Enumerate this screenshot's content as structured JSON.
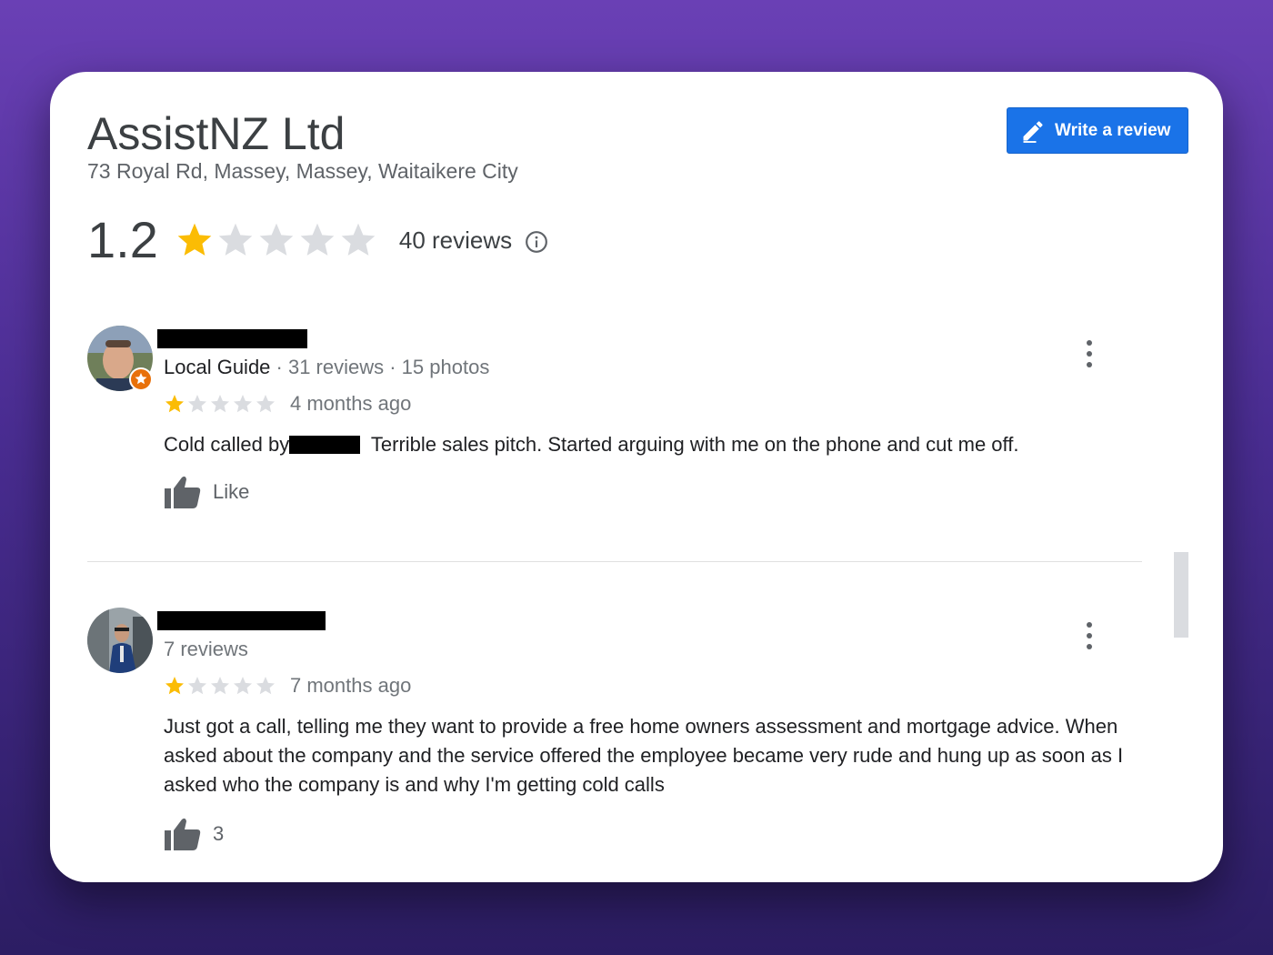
{
  "business": {
    "name": "AssistNZ Ltd",
    "address": "73 Royal Rd, Massey, Massey, Waitaikere City",
    "rating": "1.2",
    "rating_stars": 1,
    "reviews_label": "40 reviews"
  },
  "actions": {
    "write_review_label": "Write a review"
  },
  "colors": {
    "star_filled": "#fbbc04",
    "star_empty": "#dadce0",
    "accent": "#1a73e8"
  },
  "reviews": [
    {
      "meta_guide": "Local Guide",
      "meta_rest": " · 31 reviews · 15 photos",
      "stars": 1,
      "ago": "4 months ago",
      "text_before": "Cold called by",
      "text_after": " Terrible sales pitch. Started arguing with me on the phone and cut me off.",
      "like_label": "Like"
    },
    {
      "meta_rest": "7 reviews",
      "stars": 1,
      "ago": "7 months ago",
      "text": "Just got a call, telling me they want to provide a free home owners assessment and mortgage advice. When asked about the company and the service offered the employee became very rude and hung up as soon as I asked who the company is and why I'm getting cold calls",
      "like_label": "3"
    }
  ]
}
